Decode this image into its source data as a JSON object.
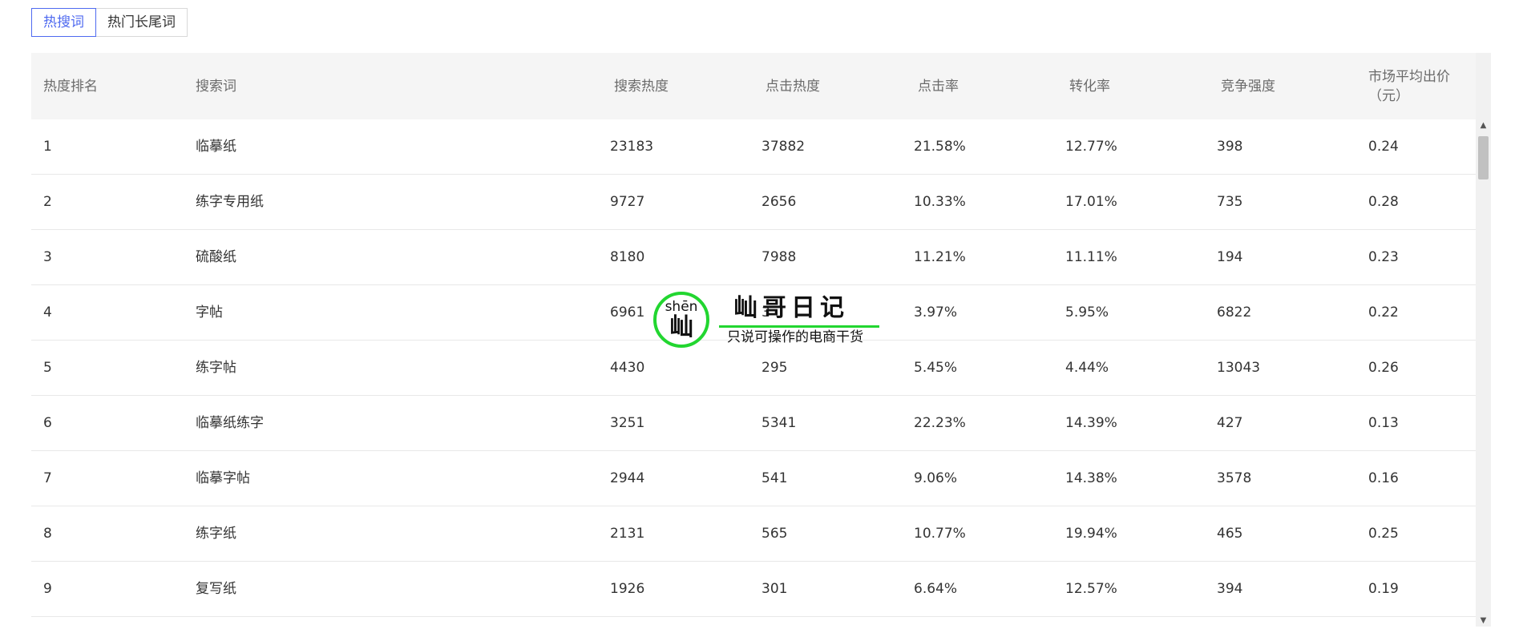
{
  "tabs": [
    {
      "label": "热搜词",
      "active": true
    },
    {
      "label": "热门长尾词",
      "active": false
    }
  ],
  "table": {
    "headers": [
      "热度排名",
      "搜索词",
      "搜索热度",
      "点击热度",
      "点击率",
      "转化率",
      "竞争强度",
      "市场平均出价（元）"
    ],
    "rows": [
      [
        "1",
        "临摹纸",
        "23183",
        "37882",
        "21.58%",
        "12.77%",
        "398",
        "0.24"
      ],
      [
        "2",
        "练字专用纸",
        "9727",
        "2656",
        "10.33%",
        "17.01%",
        "735",
        "0.28"
      ],
      [
        "3",
        "硫酸纸",
        "8180",
        "7988",
        "11.21%",
        "11.11%",
        "194",
        "0.23"
      ],
      [
        "4",
        "字帖",
        "6961",
        "3",
        "3.97%",
        "5.95%",
        "6822",
        "0.22"
      ],
      [
        "5",
        "练字帖",
        "4430",
        "295",
        "5.45%",
        "4.44%",
        "13043",
        "0.26"
      ],
      [
        "6",
        "临摹纸练字",
        "3251",
        "5341",
        "22.23%",
        "14.39%",
        "427",
        "0.13"
      ],
      [
        "7",
        "临摹字帖",
        "2944",
        "541",
        "9.06%",
        "14.38%",
        "3578",
        "0.16"
      ],
      [
        "8",
        "练字纸",
        "2131",
        "565",
        "10.77%",
        "19.94%",
        "465",
        "0.25"
      ],
      [
        "9",
        "复写纸",
        "1926",
        "301",
        "6.64%",
        "12.57%",
        "394",
        "0.19"
      ]
    ]
  },
  "watermark": {
    "pinyin": "shēn",
    "char": "屾",
    "title": "屾哥日记",
    "subtitle": "只说可操作的电商干货",
    "color": "#22d630"
  },
  "colors": {
    "accent": "#4f6af0",
    "header_bg": "#f5f5f5"
  },
  "icons": {
    "scroll_up": "triangle-up-icon",
    "scroll_down": "triangle-down-icon"
  }
}
